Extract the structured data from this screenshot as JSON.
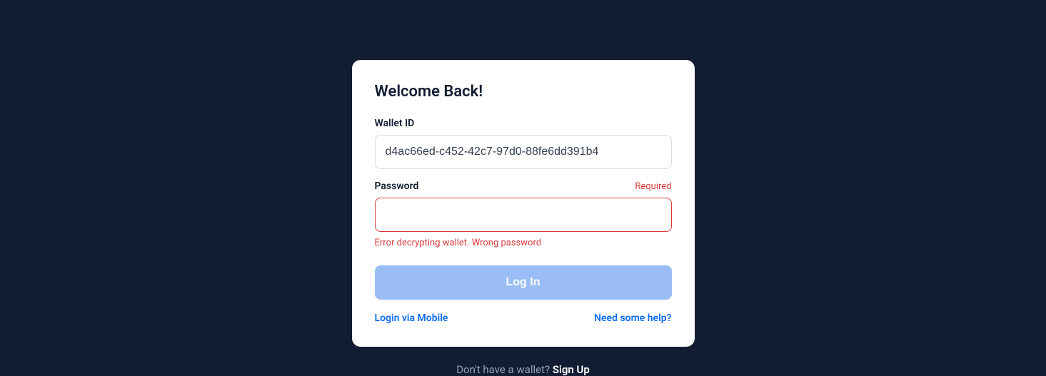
{
  "card": {
    "title": "Welcome Back!",
    "wallet": {
      "label": "Wallet ID",
      "value": "d4ac66ed-c452-42c7-97d0-88fe6dd391b4"
    },
    "password": {
      "label": "Password",
      "required": "Required",
      "value": "",
      "error": "Error decrypting wallet. Wrong password"
    },
    "loginButton": "Log In",
    "links": {
      "mobile": "Login via Mobile",
      "help": "Need some help?"
    }
  },
  "signup": {
    "prompt": "Don't have a wallet? ",
    "link": "Sign Up"
  }
}
